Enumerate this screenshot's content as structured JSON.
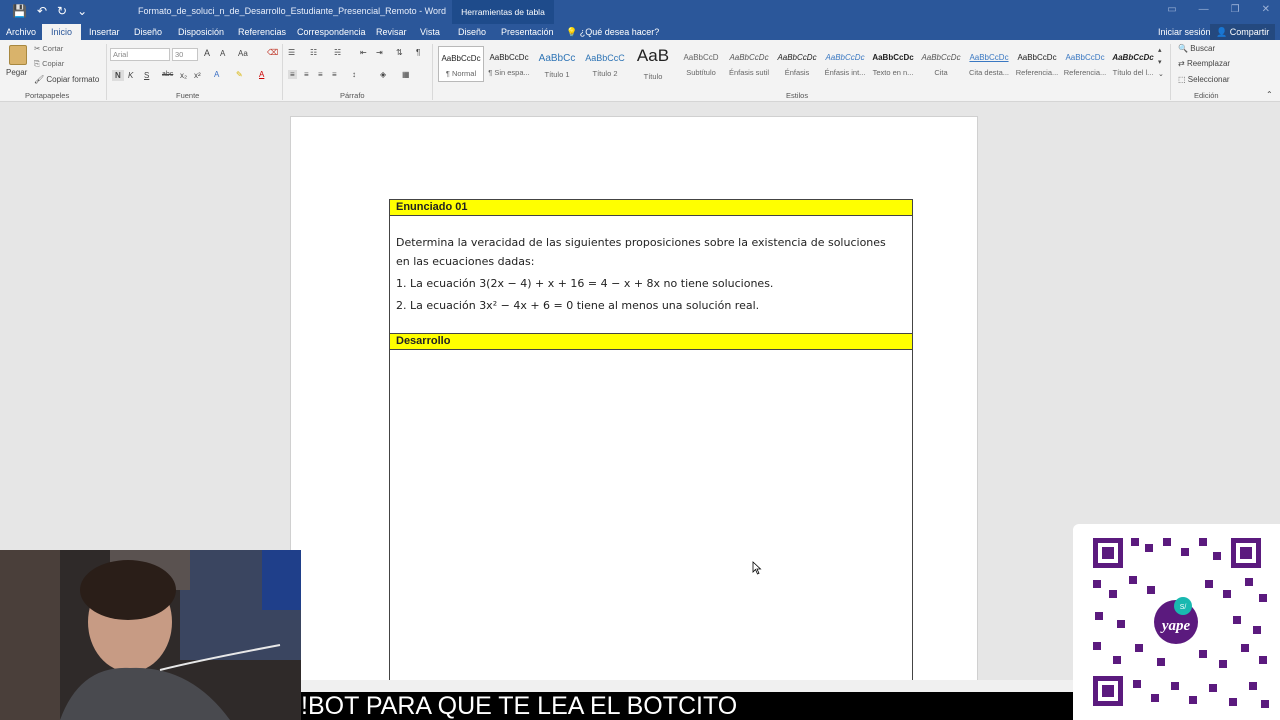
{
  "titlebar": {
    "doc_title": "Formato_de_soluci_n_de_Desarrollo_Estudiante_Presencial_Remoto - Word",
    "tools_title": "Herramientas de tabla"
  },
  "tabs": {
    "archivo": "Archivo",
    "inicio": "Inicio",
    "insertar": "Insertar",
    "diseno": "Diseño",
    "disposicion": "Disposición",
    "referencias": "Referencias",
    "correspondencia": "Correspondencia",
    "revisar": "Revisar",
    "vista": "Vista",
    "diseno2": "Diseño",
    "presentacion": "Presentación",
    "tell_me": "¿Qué desea hacer?",
    "sign_in": "Iniciar sesión",
    "share": "Compartir"
  },
  "ribbon": {
    "clipboard": {
      "paste": "Pegar",
      "cut": "Cortar",
      "copy": "Copiar",
      "format_painter": "Copiar formato",
      "label": "Portapapeles"
    },
    "font": {
      "family": "Arial",
      "size": "30",
      "bold": "N",
      "italic": "K",
      "underline": "S",
      "strike": "abc",
      "sub": "x₂",
      "sup": "x²",
      "case": "Aa",
      "grow": "A",
      "shrink": "A",
      "label": "Fuente"
    },
    "paragraph": {
      "label": "Párrafo",
      "pilcrow": "¶"
    },
    "styles": {
      "label": "Estilos",
      "items": [
        {
          "sample": "AaBbCcDc",
          "name": "¶ Normal"
        },
        {
          "sample": "AaBbCcDc",
          "name": "¶ Sin espa..."
        },
        {
          "sample": "AaBbCc",
          "name": "Título 1"
        },
        {
          "sample": "AaBbCcC",
          "name": "Título 2"
        },
        {
          "sample": "AaB",
          "name": "Título"
        },
        {
          "sample": "AaBbCcD",
          "name": "Subtítulo"
        },
        {
          "sample": "AaBbCcDc",
          "name": "Énfasis sutil"
        },
        {
          "sample": "AaBbCcDc",
          "name": "Énfasis"
        },
        {
          "sample": "AaBbCcDc",
          "name": "Énfasis int..."
        },
        {
          "sample": "AaBbCcDc",
          "name": "Texto en n..."
        },
        {
          "sample": "AaBbCcDc",
          "name": "Cita"
        },
        {
          "sample": "AaBbCcDc",
          "name": "Cita desta..."
        },
        {
          "sample": "AaBbCcDc",
          "name": "Referencia..."
        },
        {
          "sample": "AaBbCcDc",
          "name": "Referencia..."
        },
        {
          "sample": "AaBbCcDc",
          "name": "Título del l..."
        }
      ]
    },
    "editing": {
      "find": "Buscar",
      "replace": "Reemplazar",
      "select": "Seleccionar",
      "label": "Edición"
    }
  },
  "document": {
    "header1": "Enunciado 01",
    "intro_line1": "Determina la veracidad de las siguientes proposiciones sobre la existencia de soluciones",
    "intro_line2": "en las ecuaciones dadas:",
    "item1": "1. La ecuación 3(2x − 4) + x + 16 = 4 − x + 8x no tiene soluciones.",
    "item2": "2. La ecuación 3x² − 4x + 6 = 0 tiene al menos una solución real.",
    "header2": "Desarrollo"
  },
  "overlay": {
    "caption": "!BOT PARA QUE TE LEA EL BOTCITO",
    "qr_brand": "yape",
    "qr_badge": "S/"
  }
}
